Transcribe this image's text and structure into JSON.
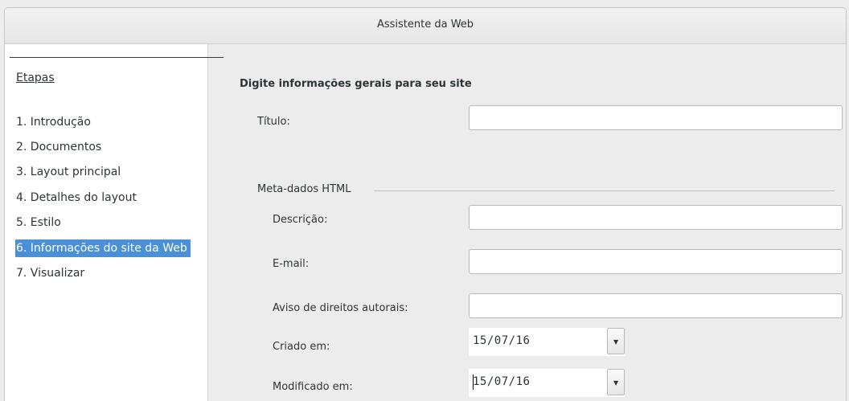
{
  "window": {
    "title": "Assistente da Web"
  },
  "steps": {
    "header": "Etapas",
    "items": [
      {
        "label": "1. Introdução"
      },
      {
        "label": "2. Documentos"
      },
      {
        "label": "3. Layout principal"
      },
      {
        "label": "4. Detalhes do layout"
      },
      {
        "label": "5. Estilo"
      },
      {
        "label": "6. Informações do site da Web"
      },
      {
        "label": "7. Visualizar"
      }
    ],
    "selected_index": 5
  },
  "form": {
    "heading": "Digite informações gerais para seu site",
    "title_label": "Título:",
    "title_value": "",
    "meta_group_label": "Meta-dados HTML",
    "description_label": "Descrição:",
    "description_value": "",
    "email_label": "E-mail:",
    "email_value": "",
    "copyright_label": "Aviso de direitos autorais:",
    "copyright_value": "",
    "created_label": "Criado em:",
    "created_value": "15/07/16",
    "modified_label": "Modificado em:",
    "modified_value": "15/07/16"
  },
  "colors": {
    "selection": "#4a90d9",
    "panel_bg": "#ffffff",
    "window_bg": "#ececec"
  },
  "icons": {
    "spin": "dropdown-spin-icon"
  }
}
